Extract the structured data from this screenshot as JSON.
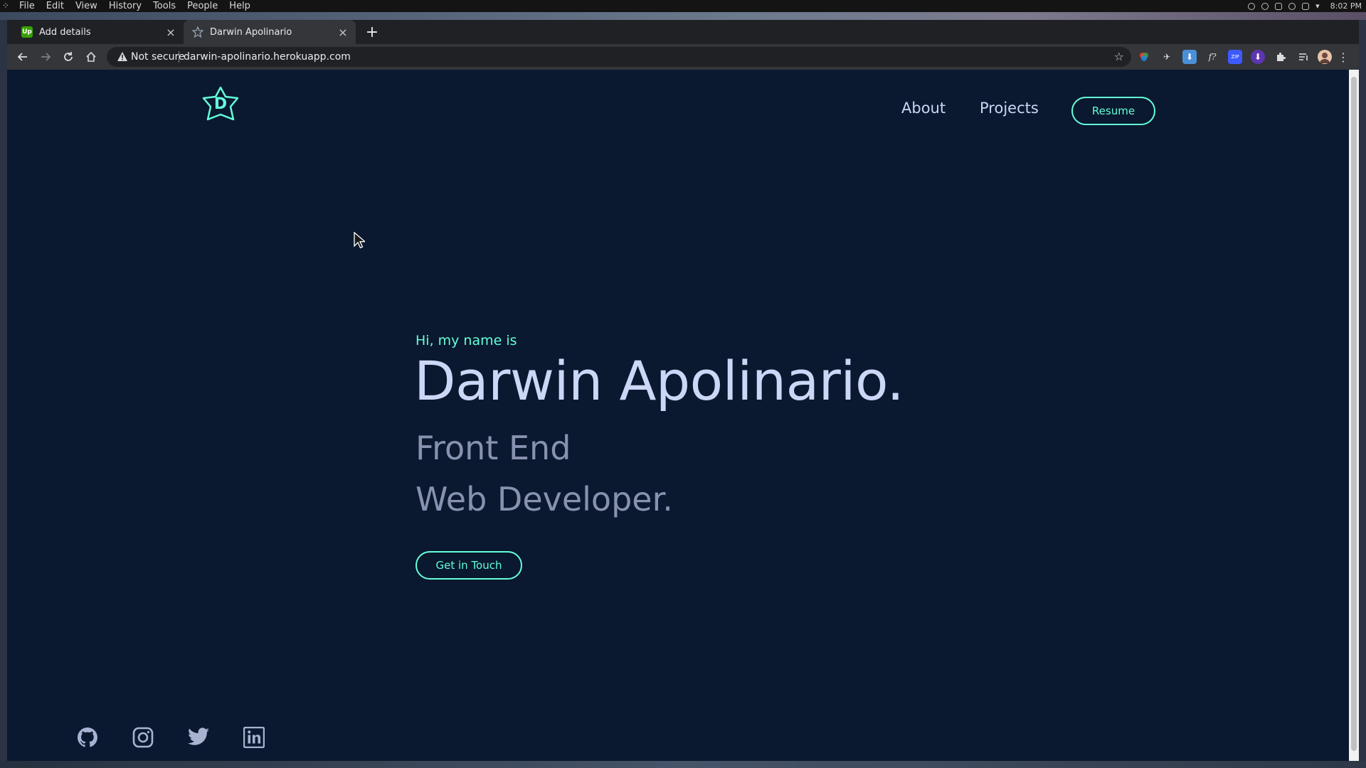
{
  "os": {
    "menu": [
      "File",
      "Edit",
      "View",
      "History",
      "Tools",
      "People",
      "Help"
    ],
    "clock": "8:02 PM"
  },
  "browser": {
    "tabs": [
      {
        "title": "Add details",
        "favicon": "upwork-icon",
        "active": false
      },
      {
        "title": "Darwin Apolinario",
        "favicon": "star-d-logo-icon",
        "active": true
      }
    ],
    "omnibox": {
      "security": "Not secure",
      "url": "darwin-apolinario.herokuapp.com"
    }
  },
  "site": {
    "logo_letter": "D",
    "nav": {
      "about": "About",
      "projects": "Projects",
      "resume": "Resume"
    },
    "hero": {
      "greeting": "Hi, my name is",
      "name": "Darwin Apolinario.",
      "role_line1": "Front End",
      "role_line2": "Web Developer.",
      "cta": "Get in Touch"
    },
    "social": [
      "github-icon",
      "instagram-icon",
      "twitter-icon",
      "linkedin-icon"
    ]
  },
  "colors": {
    "background": "#0a192f",
    "accent": "#64ffda",
    "heading": "#ccd6f6",
    "subtext": "#8892b0"
  }
}
